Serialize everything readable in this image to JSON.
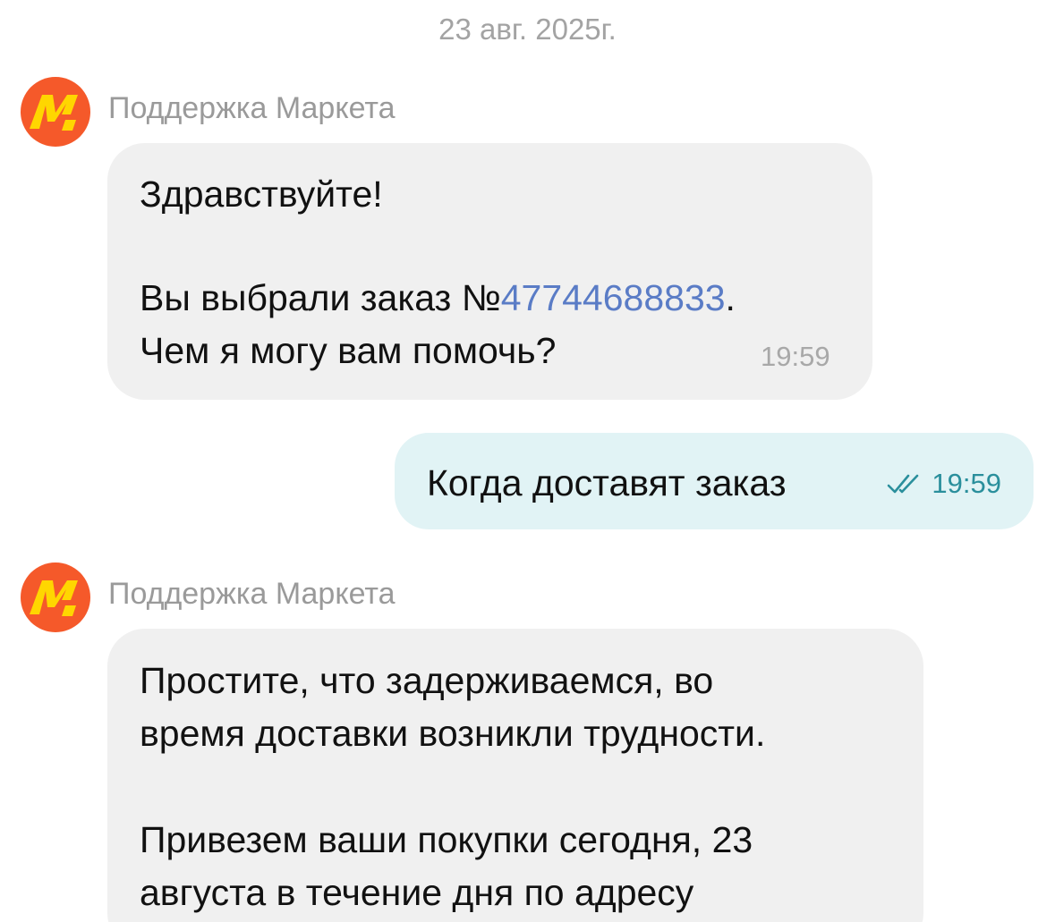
{
  "date_separator": "23 авг. 2025г.",
  "colors": {
    "incoming_bubble": "#f0f0f0",
    "outgoing_bubble": "#e1f3f5",
    "link": "#5a7cc6",
    "read_check": "#2a8f9c",
    "avatar_bg": "#f5592a",
    "avatar_logo": "#ffd600"
  },
  "messages": [
    {
      "direction": "incoming",
      "sender": "Поддержка Маркета",
      "avatar_icon": "yandex-market-logo-icon",
      "line1": "Здравствуйте!",
      "line2_prefix": "Вы выбрали заказ №",
      "order_number": "47744688833",
      "line2_suffix": ".",
      "line3": "Чем я могу вам помочь?",
      "time": "19:59"
    },
    {
      "direction": "outgoing",
      "text": "Когда доставят заказ",
      "status_icon": "double-check-icon",
      "time": "19:59"
    },
    {
      "direction": "incoming",
      "sender": "Поддержка Маркета",
      "avatar_icon": "yandex-market-logo-icon",
      "line1": "Простите, что задерживаемся, во",
      "line2": "время доставки возникли трудности.",
      "line3": "Привезем ваши покупки сегодня, 23",
      "line4": "августа в течение дня по адресу"
    }
  ]
}
